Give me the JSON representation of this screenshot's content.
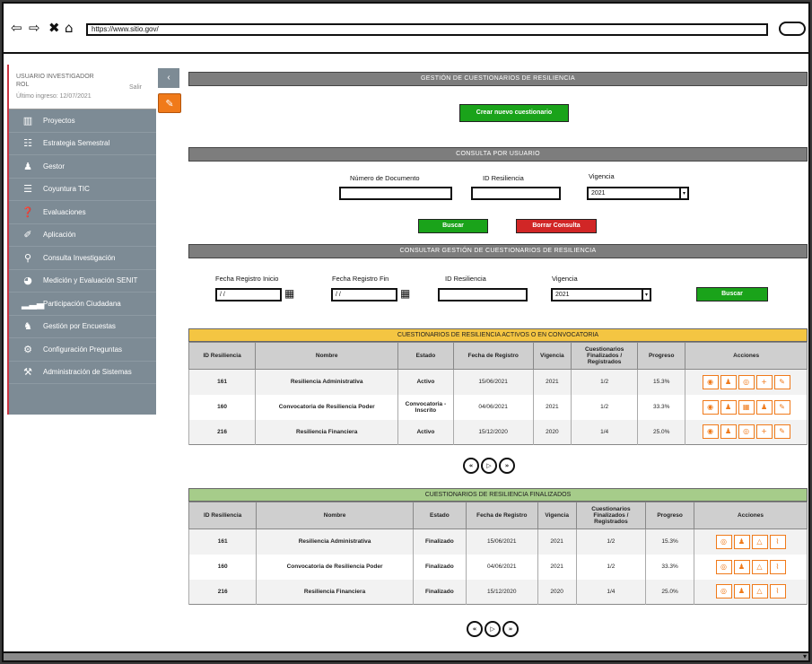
{
  "browser": {
    "back_icon": "⇦",
    "forward_icon": "⇨",
    "close_icon": "✖",
    "home_icon": "⌂",
    "url": "https://www.sitio.gov/"
  },
  "sidebar": {
    "user_name": "USUARIO INVESTIGADOR",
    "user_role": "ROL",
    "user_meta": "Último ingreso: 12/07/2021",
    "user_link": "Salir",
    "collapse_icon": "‹",
    "tool_icon": "✎",
    "items": [
      {
        "label": "Proyectos",
        "icon": "▥"
      },
      {
        "label": "Estrategia Semestral",
        "icon": "☷"
      },
      {
        "label": "Gestor",
        "icon": "♟"
      },
      {
        "label": "Coyuntura TIC",
        "icon": "☰"
      },
      {
        "label": "Evaluaciones",
        "icon": "❓"
      },
      {
        "label": "Aplicación",
        "icon": "✐"
      },
      {
        "label": "Consulta Investigación",
        "icon": "⚲"
      },
      {
        "label": "Medición y Evaluación SENIT",
        "icon": "◕"
      },
      {
        "label": "Participación Ciudadana",
        "icon": "▂▃▄"
      },
      {
        "label": "Gestión por Encuestas",
        "icon": "♞"
      },
      {
        "label": "Configuración Preguntas",
        "icon": "⚙"
      },
      {
        "label": "Administración de Sistemas",
        "icon": "⚒"
      }
    ]
  },
  "section1": {
    "title": "GESTIÓN DE CUESTIONARIOS DE RESILIENCIA",
    "create_button": "Crear nuevo cuestionario"
  },
  "section2": {
    "title": "CONSULTA POR USUARIO",
    "doc_label": "Número de Documento",
    "id_label": "ID Resiliencia",
    "year_label": "Vigencia",
    "year_value": "2021",
    "search_button": "Buscar",
    "clear_button": "Borrar Consulta"
  },
  "section3": {
    "title": "CONSULTAR GESTIÓN DE CUESTIONARIOS DE RESILIENCIA",
    "date_from_label": "Fecha Registro Inicio",
    "date_to_label": "Fecha Registro Fin",
    "id_label": "ID Resiliencia",
    "year_label": "Vigencia",
    "date_from_value": "/ /",
    "date_to_value": "/ /",
    "year_value": "2021",
    "search_button": "Buscar"
  },
  "active_table": {
    "title": "CUESTIONARIOS DE RESILIENCIA ACTIVOS O EN CONVOCATORIA",
    "headers": [
      "ID Resiliencia",
      "Nombre",
      "Estado",
      "Fecha de Registro",
      "Vigencia",
      "Cuestionarios Finalizados / Registrados",
      "Progreso",
      "Acciones"
    ],
    "rows": [
      {
        "id": "161",
        "name": "Resiliencia Administrativa",
        "state": "Activo",
        "date": "15/06/2021",
        "year": "2021",
        "ratio": "1/2",
        "progress": "15.3%"
      },
      {
        "id": "160",
        "name": "Convocatoria de Resiliencia Poder",
        "state": "Convocatoria - Inscrito",
        "date": "04/06/2021",
        "year": "2021",
        "ratio": "1/2",
        "progress": "33.3%"
      },
      {
        "id": "216",
        "name": "Resiliencia Financiera",
        "state": "Activo",
        "date": "15/12/2020",
        "year": "2020",
        "ratio": "1/4",
        "progress": "25.0%"
      }
    ]
  },
  "finished_table": {
    "title": "CUESTIONARIOS DE RESILIENCIA FINALIZADOS",
    "headers": [
      "ID Resiliencia",
      "Nombre",
      "Estado",
      "Fecha de Registro",
      "Vigencia",
      "Cuestionarios Finalizados / Registrados",
      "Progreso",
      "Acciones"
    ],
    "rows": [
      {
        "id": "161",
        "name": "Resiliencia Administrativa",
        "state": "Finalizado",
        "date": "15/06/2021",
        "year": "2021",
        "ratio": "1/2",
        "progress": "15.3%"
      },
      {
        "id": "160",
        "name": "Convocatoria de Resiliencia Poder",
        "state": "Finalizado",
        "date": "04/06/2021",
        "year": "2021",
        "ratio": "1/2",
        "progress": "33.3%"
      },
      {
        "id": "216",
        "name": "Resiliencia Financiera",
        "state": "Finalizado",
        "date": "15/12/2020",
        "year": "2020",
        "ratio": "1/4",
        "progress": "25.0%"
      }
    ]
  },
  "pager1": [
    "«",
    "▷",
    "»"
  ],
  "pager2": [
    "«",
    "▷",
    "»"
  ]
}
